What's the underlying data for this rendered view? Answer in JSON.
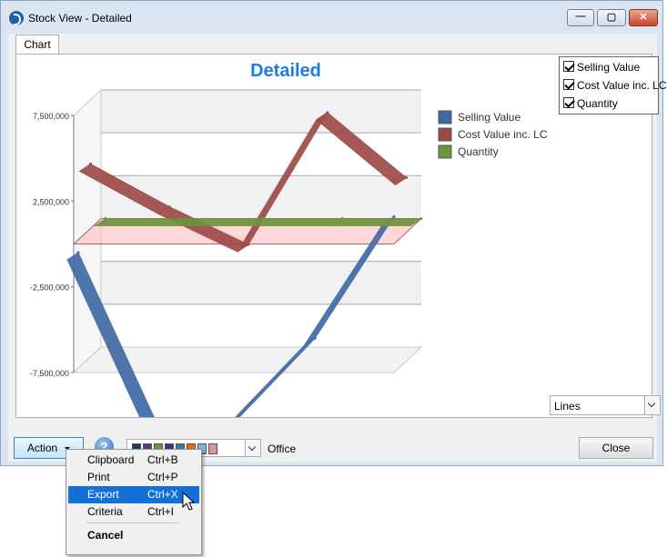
{
  "window": {
    "title": "Stock View - Detailed",
    "btn_minimize": "—",
    "btn_maximize": "▢",
    "btn_close": "✕"
  },
  "tab": {
    "label": "Chart"
  },
  "chart_data": {
    "type": "line",
    "render": "3d-ribbon",
    "title": "Detailed",
    "title_color": "#1a7ee8",
    "y_tick_labels": [
      "7,500,000",
      "2,500,000",
      "-2,500,000",
      "-7,500,000"
    ],
    "ylim": [
      -7500000,
      7500000
    ],
    "grid": true,
    "legend_position": "top-right",
    "series": [
      {
        "name": "Selling Value",
        "color": "#3f6aa6",
        "values": [
          -500000,
          -10500000,
          -10300000,
          -5500000,
          1600000
        ]
      },
      {
        "name": "Cost Value inc. LC",
        "color": "#9e4a48",
        "values": [
          4000000,
          1500000,
          -700000,
          7000000,
          3200000
        ]
      },
      {
        "name": "Quantity",
        "color": "#6f933f",
        "values": [
          3000,
          3000,
          3000,
          3000,
          3000
        ]
      }
    ]
  },
  "series_toggles": [
    {
      "label": "Selling Value",
      "checked": true
    },
    {
      "label": "Cost Value inc. LC",
      "checked": true
    },
    {
      "label": "Quantity",
      "checked": true
    }
  ],
  "chart_type_select": {
    "value": "Lines"
  },
  "action_button": {
    "label": "Action"
  },
  "palette": {
    "name": "Office",
    "swatches": [
      "#1f3864",
      "#5b3a7a",
      "#6f933f",
      "#3f2e8c",
      "#357ca5",
      "#e46c0a",
      "#86aee0",
      "#d99694"
    ]
  },
  "close_button": {
    "label": "Close"
  },
  "menu": {
    "items": [
      {
        "label": "Clipboard",
        "shortcut": "Ctrl+B"
      },
      {
        "label": "Print",
        "shortcut": "Ctrl+P"
      },
      {
        "label": "Export",
        "shortcut": "Ctrl+X"
      },
      {
        "label": "Criteria",
        "shortcut": "Ctrl+I"
      },
      {
        "label": "Cancel",
        "shortcut": ""
      }
    ]
  }
}
